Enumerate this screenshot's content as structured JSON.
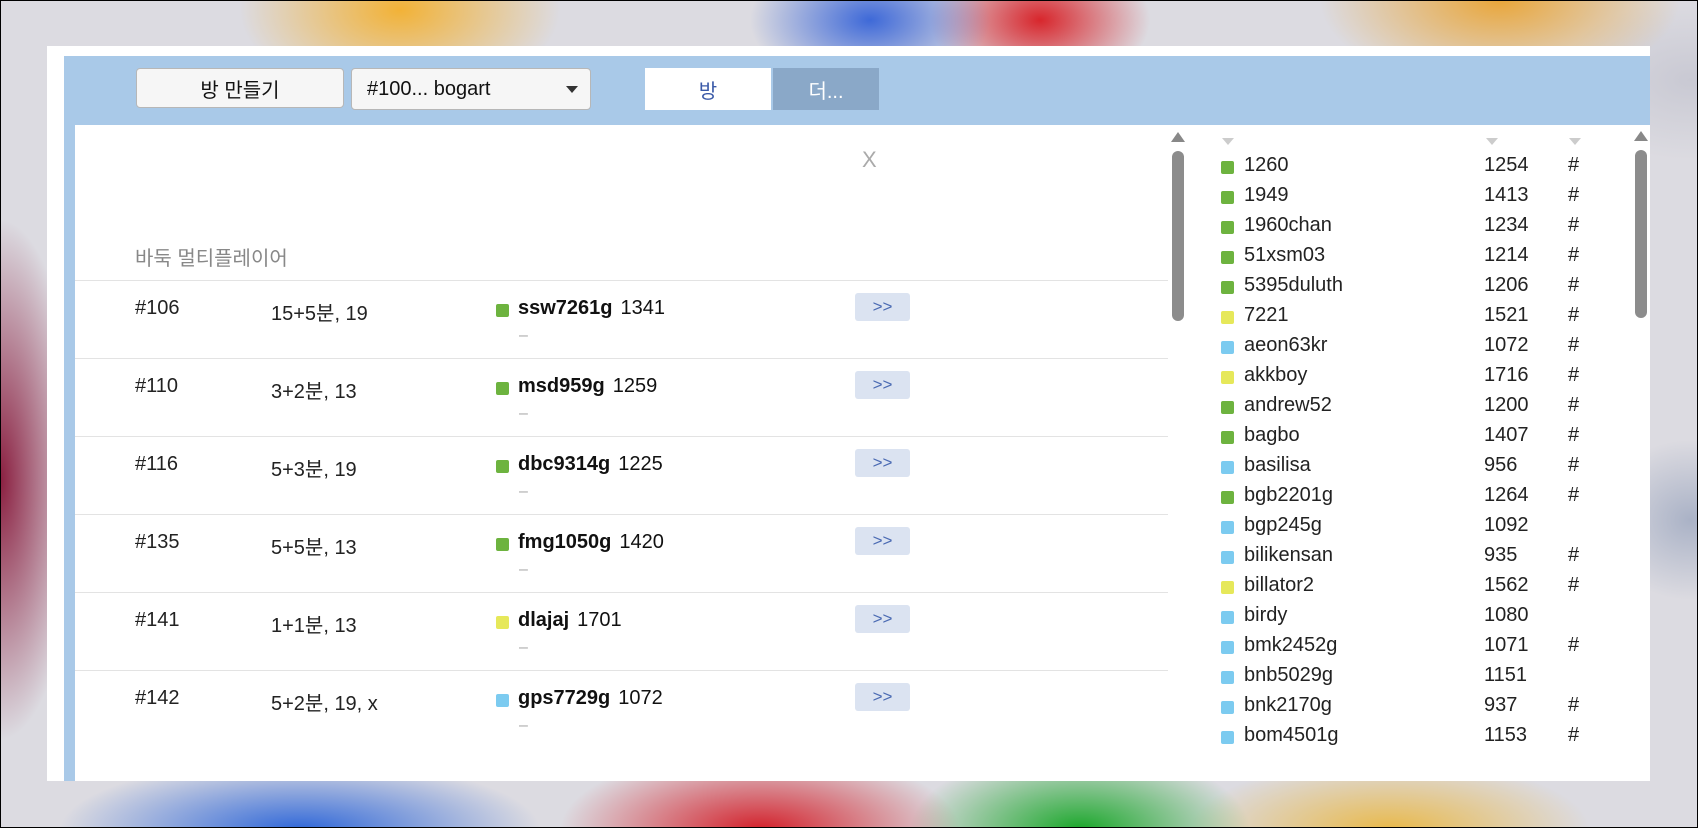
{
  "toolbar": {
    "create_room_label": "방 만들기",
    "room_select_value": "#100... bogart",
    "tab_room_label": "방",
    "tab_more_label": "더..."
  },
  "left_panel": {
    "close_label": "X",
    "game_title": "바둑 멀티플레이어",
    "rooms": [
      {
        "id": "#106",
        "time": "15+5분, 19",
        "player": "ssw7261g",
        "rating": "1341",
        "dash": "–",
        "join": ">>",
        "color": "#6db33f"
      },
      {
        "id": "#110",
        "time": "3+2분, 13",
        "player": "msd959g",
        "rating": "1259",
        "dash": "–",
        "join": ">>",
        "color": "#6db33f"
      },
      {
        "id": "#116",
        "time": "5+3분, 19",
        "player": "dbc9314g",
        "rating": "1225",
        "dash": "–",
        "join": ">>",
        "color": "#6db33f"
      },
      {
        "id": "#135",
        "time": "5+5분, 13",
        "player": "fmg1050g",
        "rating": "1420",
        "dash": "–",
        "join": ">>",
        "color": "#6db33f"
      },
      {
        "id": "#141",
        "time": "1+1분, 13",
        "player": "dlajaj",
        "rating": "1701",
        "dash": "–",
        "join": ">>",
        "color": "#e6e85a"
      },
      {
        "id": "#142",
        "time": "5+2분, 19, x",
        "player": "gps7729g",
        "rating": "1072",
        "dash": "–",
        "join": ">>",
        "color": "#7ccbf0"
      }
    ]
  },
  "right_panel": {
    "users": [
      {
        "name": "1260",
        "rating": "1254",
        "hash": "#",
        "color": "#6db33f"
      },
      {
        "name": "1949",
        "rating": "1413",
        "hash": "#",
        "color": "#6db33f"
      },
      {
        "name": "1960chan",
        "rating": "1234",
        "hash": "#",
        "color": "#6db33f"
      },
      {
        "name": "51xsm03",
        "rating": "1214",
        "hash": "#",
        "color": "#6db33f"
      },
      {
        "name": "5395duluth",
        "rating": "1206",
        "hash": "#",
        "color": "#6db33f"
      },
      {
        "name": "7221",
        "rating": "1521",
        "hash": "#",
        "color": "#e6e85a"
      },
      {
        "name": "aeon63kr",
        "rating": "1072",
        "hash": "#",
        "color": "#7ccbf0"
      },
      {
        "name": "akkboy",
        "rating": "1716",
        "hash": "#",
        "color": "#e6e85a"
      },
      {
        "name": "andrew52",
        "rating": "1200",
        "hash": "#",
        "color": "#6db33f"
      },
      {
        "name": "bagbo",
        "rating": "1407",
        "hash": "#",
        "color": "#6db33f"
      },
      {
        "name": "basilisa",
        "rating": "956",
        "hash": "#",
        "color": "#7ccbf0"
      },
      {
        "name": "bgb2201g",
        "rating": "1264",
        "hash": "#",
        "color": "#6db33f"
      },
      {
        "name": "bgp245g",
        "rating": "1092",
        "hash": "",
        "color": "#7ccbf0"
      },
      {
        "name": "bilikensan",
        "rating": "935",
        "hash": "#",
        "color": "#7ccbf0"
      },
      {
        "name": "billator2",
        "rating": "1562",
        "hash": "#",
        "color": "#e6e85a"
      },
      {
        "name": "birdy",
        "rating": "1080",
        "hash": "",
        "color": "#7ccbf0"
      },
      {
        "name": "bmk2452g",
        "rating": "1071",
        "hash": "#",
        "color": "#7ccbf0"
      },
      {
        "name": "bnb5029g",
        "rating": "1151",
        "hash": "",
        "color": "#7ccbf0"
      },
      {
        "name": "bnk2170g",
        "rating": "937",
        "hash": "#",
        "color": "#7ccbf0"
      },
      {
        "name": "bom4501g",
        "rating": "1153",
        "hash": "#",
        "color": "#7ccbf0"
      }
    ]
  }
}
